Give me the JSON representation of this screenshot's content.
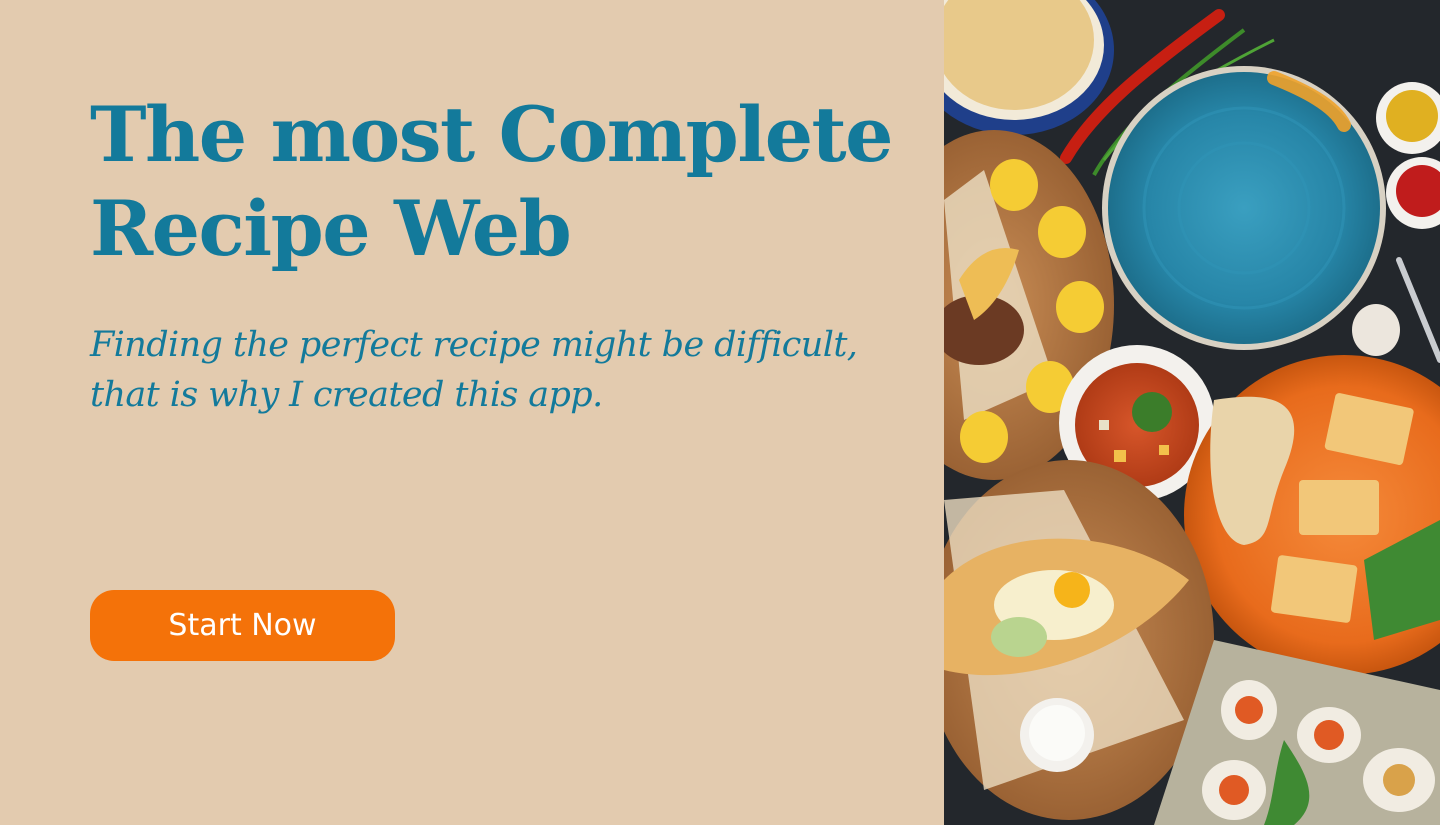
{
  "hero": {
    "title_line1": "The most Complete",
    "title_line2": "Recipe Web",
    "subtitle_line1": "Finding the perfect recipe might be difficult,",
    "subtitle_line2": "that is why I created this app.",
    "cta_label": "Start Now"
  },
  "colors": {
    "background": "#e3cbaf",
    "heading": "#137a9b",
    "cta": "#f47209",
    "cta_text": "#ffffff"
  },
  "photo": {
    "icon": "food-photo",
    "items": [
      "bread-plate",
      "chili-pepper",
      "blue-plate",
      "sauce-bowl-mustard",
      "sauce-bowl-ketchup",
      "wooden-board-dumplings",
      "soup-bowl",
      "orange-plate-hummus",
      "khachapuri-board",
      "yogurt-bowl",
      "chips-tray",
      "fork",
      "garlic"
    ]
  }
}
